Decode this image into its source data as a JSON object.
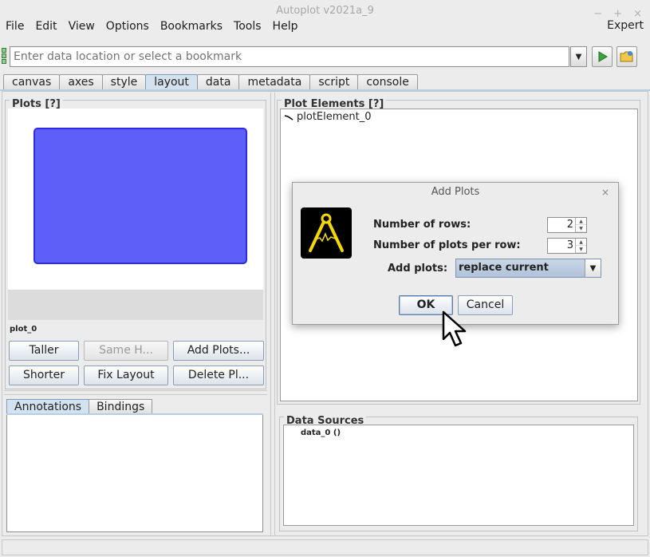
{
  "window": {
    "title": "Autoplot v2021a_9",
    "controls": [
      "−",
      "+",
      "×"
    ]
  },
  "menu": {
    "items": [
      "File",
      "Edit",
      "View",
      "Options",
      "Bookmarks",
      "Tools",
      "Help"
    ],
    "expert": "Expert"
  },
  "address": {
    "placeholder": "Enter data location or select a bookmark"
  },
  "tabs": [
    "canvas",
    "axes",
    "style",
    "layout",
    "data",
    "metadata",
    "script",
    "console"
  ],
  "active_tab": "layout",
  "plots_panel": {
    "title": "Plots [?]",
    "plot_label": "plot_0",
    "buttons": {
      "taller": "Taller",
      "same_height": "Same H...",
      "add_plots": "Add Plots...",
      "shorter": "Shorter",
      "fix_layout": "Fix Layout",
      "delete_plot": "Delete Pl..."
    }
  },
  "subtabs": [
    "Annotations",
    "Bindings"
  ],
  "plot_elements": {
    "title": "Plot Elements [?]",
    "items": [
      "plotElement_0"
    ]
  },
  "data_sources": {
    "title": "Data Sources",
    "items": [
      "data_0 ()"
    ]
  },
  "dialog": {
    "title": "Add Plots",
    "close": "×",
    "rows_label": "Number of rows:",
    "rows_value": "2",
    "per_row_label": "Number of plots per row:",
    "per_row_value": "3",
    "add_plots_label": "Add plots:",
    "add_plots_value": "replace current",
    "ok": "OK",
    "cancel": "Cancel"
  },
  "colors": {
    "plot_fill": "#5e5ef9",
    "tab_active": "#d4e1ef",
    "logo_yellow": "#f5d800"
  }
}
